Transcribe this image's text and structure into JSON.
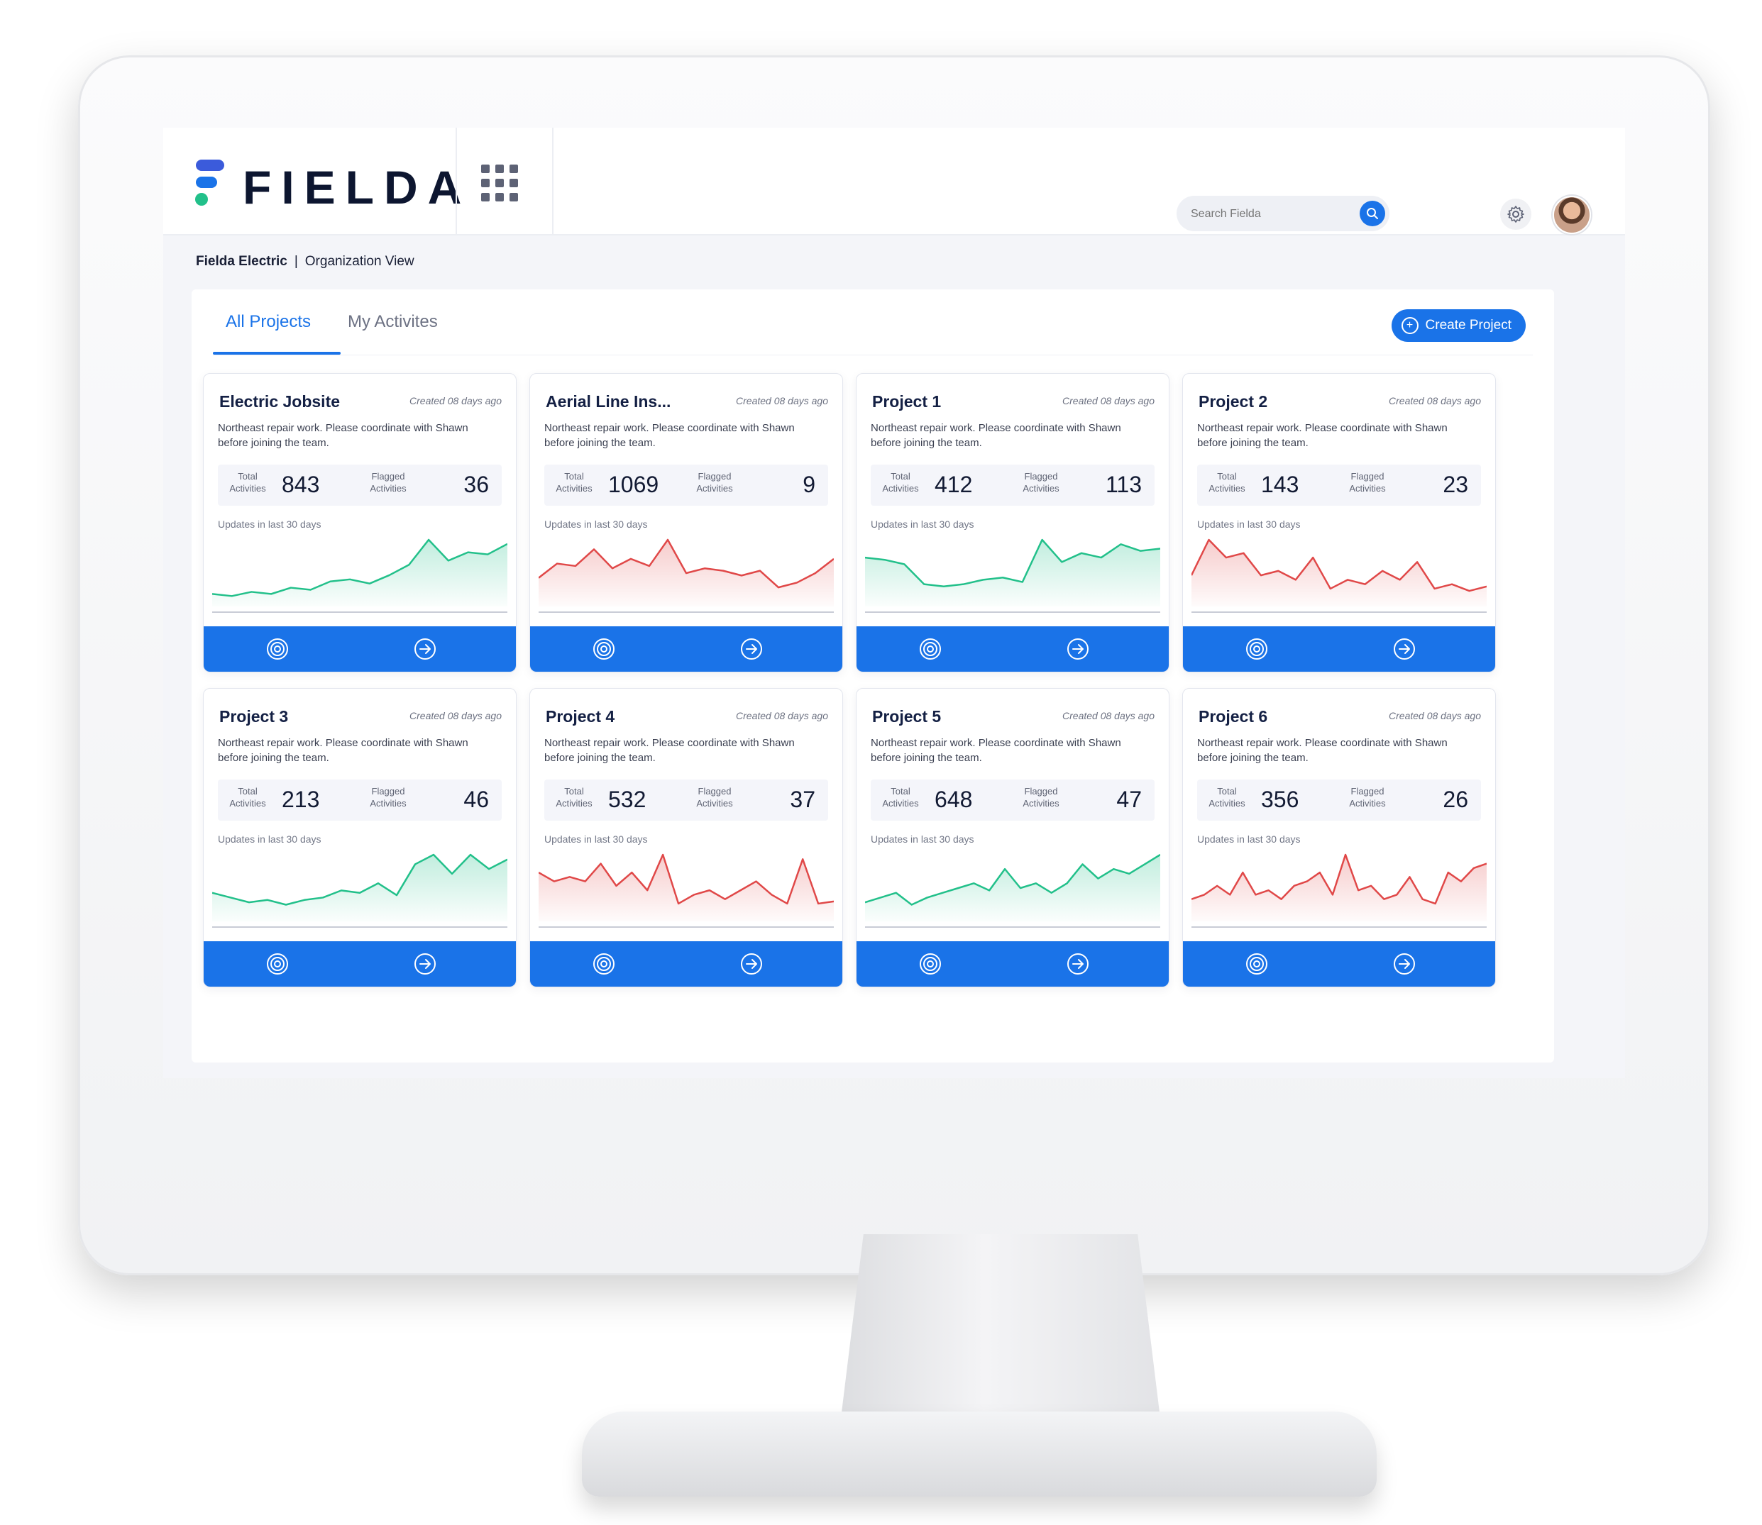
{
  "colors": {
    "accent": "#1a73e8",
    "up": "#22c08a",
    "down": "#e04848",
    "logo_blue": "#3b5bdb",
    "logo_green": "#22c08a"
  },
  "brand": {
    "name": "FIELDA"
  },
  "header": {
    "search": {
      "placeholder": "Search Fielda",
      "icon": "search-icon"
    },
    "settings_icon": "gear-icon",
    "apps_icon": "grid-icon"
  },
  "breadcrumb": {
    "org": "Fielda Electric",
    "separator": "|",
    "view": "Organization View"
  },
  "tabs": [
    {
      "label": "All Projects",
      "active": true
    },
    {
      "label": "My Activites",
      "active": false
    }
  ],
  "create_button": {
    "label": "Create Project",
    "icon": "plus-circle-icon"
  },
  "projects": [
    {
      "title": "Electric Jobsite",
      "created": "Created 08 days ago",
      "description": "Northeast repair work. Please coordinate with Shawn before joining the team.",
      "total_label": "Total Activities",
      "total": "843",
      "flagged_label": "Flagged Activities",
      "flagged": "36",
      "updates_label": "Updates in last 30 days",
      "trend": "up",
      "spark": [
        6,
        5,
        7,
        6,
        9,
        8,
        12,
        13,
        11,
        15,
        20,
        32,
        22,
        26,
        25,
        30
      ]
    },
    {
      "title": "Aerial Line Ins...",
      "created": "Created 08 days ago",
      "description": "Northeast repair work. Please coordinate with Shawn before joining the team.",
      "total_label": "Total Activities",
      "total": "1069",
      "flagged_label": "Flagged Activities",
      "flagged": "9",
      "updates_label": "Updates in last 30 days",
      "trend": "down",
      "spark": [
        12,
        18,
        17,
        24,
        16,
        20,
        17,
        28,
        14,
        16,
        15,
        13,
        15,
        8,
        10,
        14,
        20
      ]
    },
    {
      "title": "Project 1",
      "created": "Created 08 days ago",
      "description": "Northeast repair work. Please coordinate with Shawn before joining the team.",
      "total_label": "Total Activities",
      "total": "412",
      "flagged_label": "Flagged Activities",
      "flagged": "113",
      "updates_label": "Updates in last 30 days",
      "trend": "up",
      "spark": [
        22,
        21,
        19,
        10,
        9,
        10,
        12,
        13,
        11,
        30,
        20,
        24,
        22,
        28,
        25,
        26
      ]
    },
    {
      "title": "Project 2",
      "created": "Created 08 days ago",
      "description": "Northeast repair work. Please coordinate with Shawn before joining the team.",
      "total_label": "Total Activities",
      "total": "143",
      "flagged_label": "Flagged Activities",
      "flagged": "23",
      "updates_label": "Updates in last 30 days",
      "trend": "down",
      "spark": [
        14,
        30,
        22,
        24,
        14,
        16,
        12,
        22,
        8,
        12,
        10,
        16,
        12,
        20,
        8,
        10,
        7,
        9
      ]
    },
    {
      "title": "Project 3",
      "created": "Created 08 days ago",
      "description": "Northeast repair work. Please coordinate with Shawn before joining the team.",
      "total_label": "Total Activities",
      "total": "213",
      "flagged_label": "Flagged Activities",
      "flagged": "46",
      "updates_label": "Updates in last 30 days",
      "trend": "up",
      "spark": [
        12,
        10,
        8,
        9,
        7,
        9,
        10,
        13,
        12,
        16,
        11,
        24,
        28,
        20,
        28,
        22,
        26
      ]
    },
    {
      "title": "Project 4",
      "created": "Created 08 days ago",
      "description": "Northeast repair work. Please coordinate with Shawn before joining the team.",
      "total_label": "Total Activities",
      "total": "532",
      "flagged_label": "Flagged Activities",
      "flagged": "37",
      "updates_label": "Updates in last 30 days",
      "trend": "down",
      "spark": [
        22,
        18,
        20,
        18,
        26,
        16,
        22,
        14,
        30,
        8,
        12,
        14,
        10,
        14,
        18,
        12,
        8,
        28,
        8,
        9
      ]
    },
    {
      "title": "Project 5",
      "created": "Created 08 days ago",
      "description": "Northeast repair work. Please coordinate with Shawn before joining the team.",
      "total_label": "Total Activities",
      "total": "648",
      "flagged_label": "Flagged Activities",
      "flagged": "47",
      "updates_label": "Updates in last 30 days",
      "trend": "up",
      "spark": [
        8,
        10,
        12,
        7,
        10,
        12,
        14,
        16,
        13,
        22,
        14,
        16,
        12,
        16,
        24,
        18,
        22,
        20,
        24,
        28
      ]
    },
    {
      "title": "Project 6",
      "created": "Created 08 days ago",
      "description": "Northeast repair work. Please coordinate with Shawn before joining the team.",
      "total_label": "Total Activities",
      "total": "356",
      "flagged_label": "Flagged Activities",
      "flagged": "26",
      "updates_label": "Updates in last 30 days",
      "trend": "down",
      "spark": [
        10,
        12,
        16,
        12,
        22,
        12,
        14,
        10,
        16,
        18,
        22,
        12,
        30,
        14,
        16,
        10,
        12,
        20,
        10,
        8,
        22,
        18,
        24,
        26
      ]
    }
  ],
  "card_icons": {
    "target": "target-icon",
    "open": "arrow-right-circle-icon"
  }
}
